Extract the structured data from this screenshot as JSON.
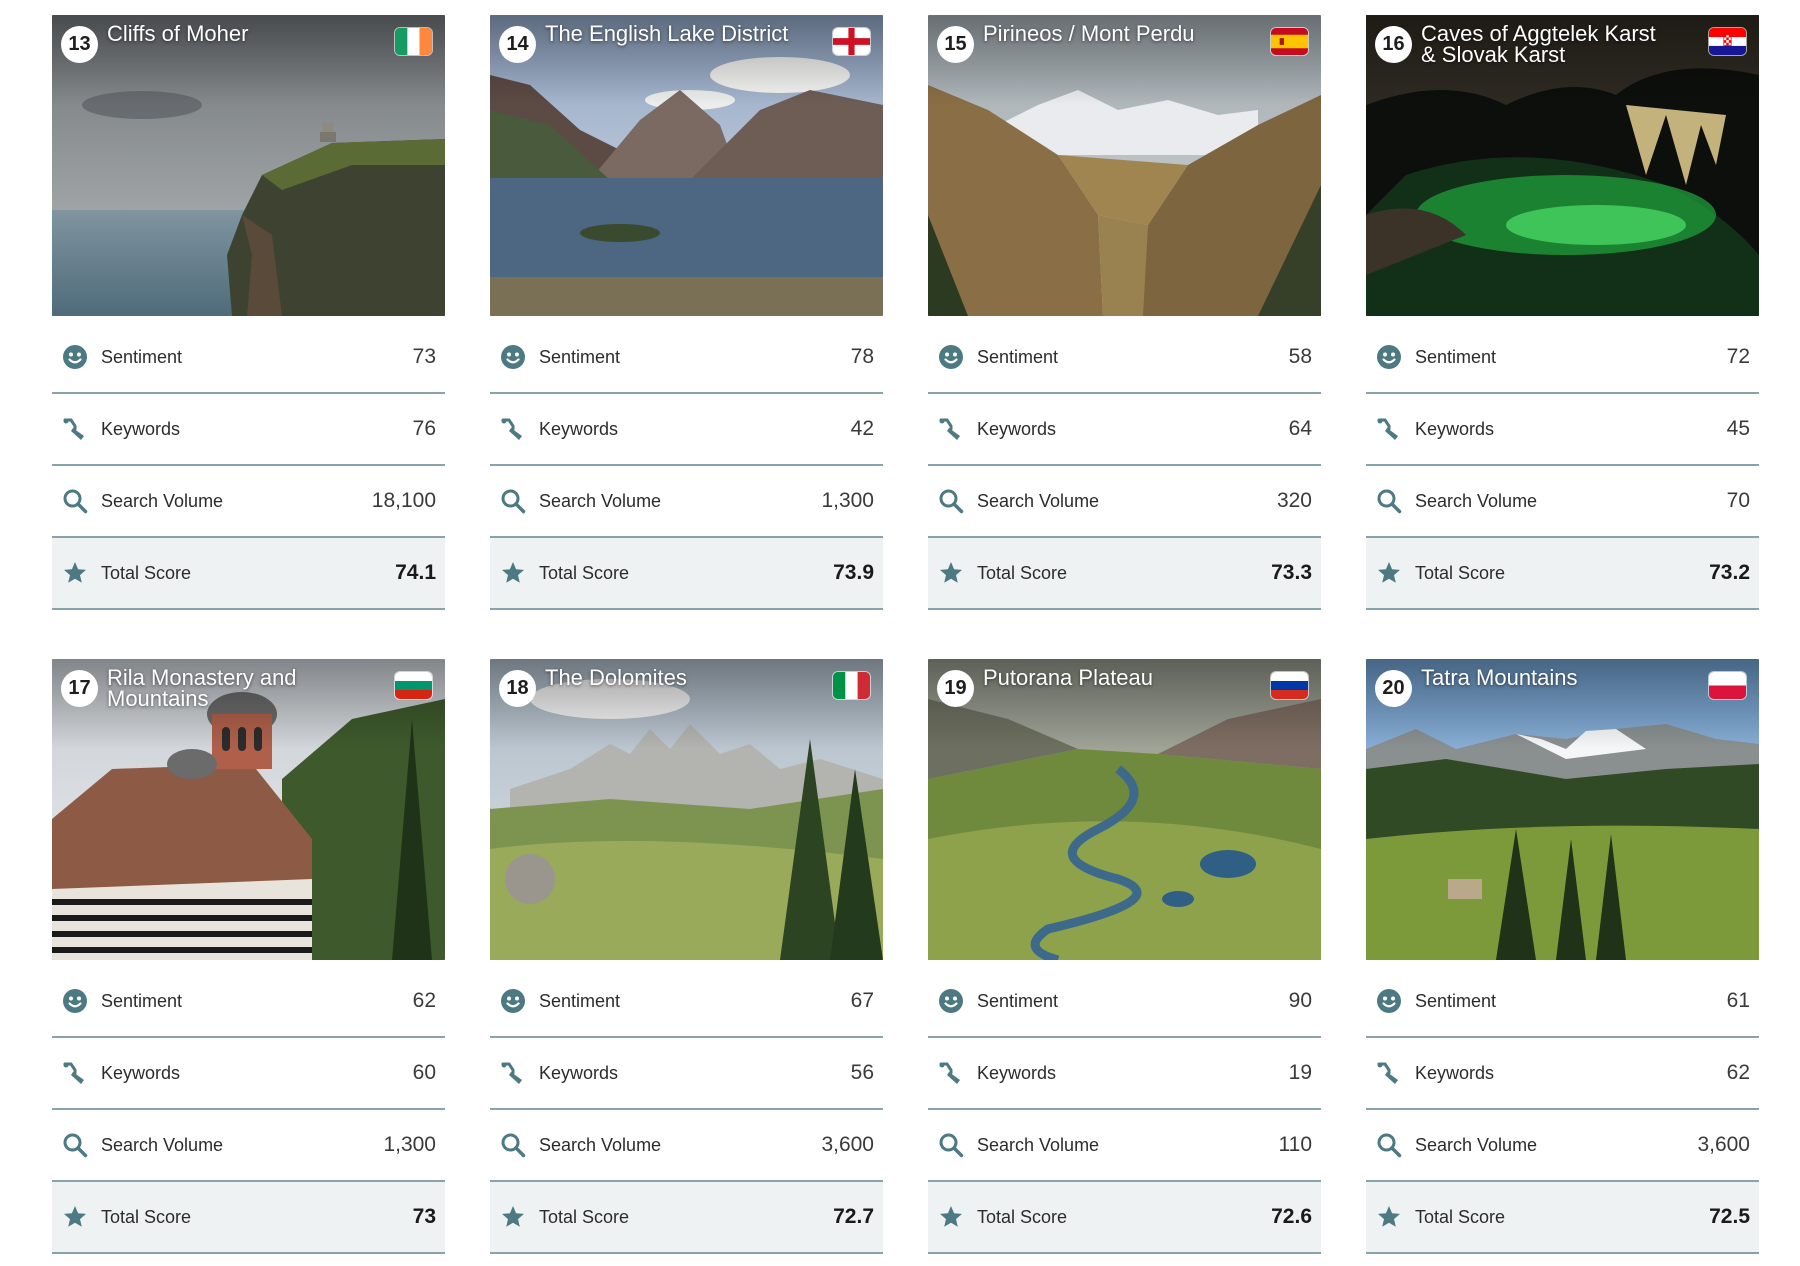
{
  "labels": {
    "sentiment": "Sentiment",
    "keywords": "Keywords",
    "search_volume": "Search Volume",
    "total_score": "Total Score"
  },
  "colors": {
    "icon": "#4d7a82",
    "divider": "#8aa2aa",
    "total_bg": "#eef2f3"
  },
  "cards": [
    {
      "rank": "13",
      "name": "Cliffs of Moher",
      "flag": "ireland",
      "scene": "cliffs",
      "sentiment": "73",
      "keywords": "76",
      "search_volume": "18,100",
      "total_score": "74.1"
    },
    {
      "rank": "14",
      "name": "The English Lake District",
      "flag": "england",
      "scene": "lake",
      "sentiment": "78",
      "keywords": "42",
      "search_volume": "1,300",
      "total_score": "73.9"
    },
    {
      "rank": "15",
      "name": "Pirineos / Mont Perdu",
      "flag": "spain",
      "scene": "canyon",
      "sentiment": "58",
      "keywords": "64",
      "search_volume": "320",
      "total_score": "73.3"
    },
    {
      "rank": "16",
      "name": "Caves of Aggtelek Karst & Slovak Karst",
      "flag": "croatia",
      "scene": "cave",
      "sentiment": "72",
      "keywords": "45",
      "search_volume": "70",
      "total_score": "73.2"
    },
    {
      "rank": "17",
      "name": "Rila Monastery and Mountains",
      "flag": "bulgaria",
      "scene": "monastery",
      "sentiment": "62",
      "keywords": "60",
      "search_volume": "1,300",
      "total_score": "73"
    },
    {
      "rank": "18",
      "name": "The Dolomites",
      "flag": "italy",
      "scene": "dolomites",
      "sentiment": "67",
      "keywords": "56",
      "search_volume": "3,600",
      "total_score": "72.7"
    },
    {
      "rank": "19",
      "name": "Putorana Plateau",
      "flag": "russia",
      "scene": "plateau",
      "sentiment": "90",
      "keywords": "19",
      "search_volume": "110",
      "total_score": "72.6"
    },
    {
      "rank": "20",
      "name": "Tatra Mountains",
      "flag": "poland",
      "scene": "tatra",
      "sentiment": "61",
      "keywords": "62",
      "search_volume": "3,600",
      "total_score": "72.5"
    }
  ]
}
